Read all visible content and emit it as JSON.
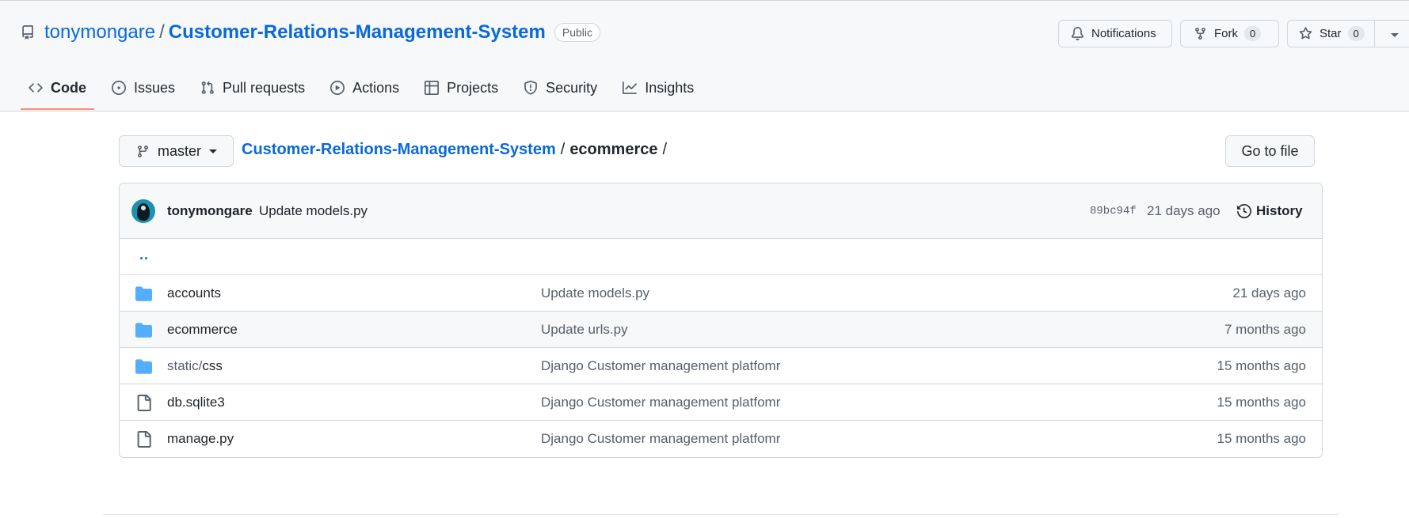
{
  "repo": {
    "owner": "tonymongare",
    "name": "Customer-Relations-Management-System",
    "visibility": "Public"
  },
  "header_actions": {
    "notifications_label": "Notifications",
    "fork_label": "Fork",
    "fork_count": "0",
    "star_label": "Star",
    "star_count": "0"
  },
  "tabs": [
    {
      "label": "Code",
      "icon": "code-icon",
      "active": true
    },
    {
      "label": "Issues",
      "icon": "issue-icon"
    },
    {
      "label": "Pull requests",
      "icon": "pull-request-icon"
    },
    {
      "label": "Actions",
      "icon": "play-icon"
    },
    {
      "label": "Projects",
      "icon": "table-icon"
    },
    {
      "label": "Security",
      "icon": "shield-icon"
    },
    {
      "label": "Insights",
      "icon": "graph-icon"
    }
  ],
  "path_bar": {
    "branch": "master",
    "breadcrumb_repo": "Customer-Relations-Management-System",
    "separator": "/",
    "current_dir": "ecommerce",
    "goto_label": "Go to file"
  },
  "latest_commit": {
    "author": "tonymongare",
    "message": "Update models.py",
    "sha": "89bc94f",
    "time": "21 days ago",
    "history_label": "History"
  },
  "parent_dir_label": "..",
  "files": [
    {
      "type": "folder",
      "name_prefix": "",
      "name": "accounts",
      "message": "Update models.py",
      "time": "21 days ago"
    },
    {
      "type": "folder",
      "name_prefix": "",
      "name": "ecommerce",
      "message": "Update urls.py",
      "time": "7 months ago"
    },
    {
      "type": "folder",
      "name_prefix": "static/",
      "name": "css",
      "message": "Django Customer management platfomr",
      "time": "15 months ago"
    },
    {
      "type": "file",
      "name_prefix": "",
      "name": "db.sqlite3",
      "message": "Django Customer management platfomr",
      "time": "15 months ago"
    },
    {
      "type": "file",
      "name_prefix": "",
      "name": "manage.py",
      "message": "Django Customer management platfomr",
      "time": "15 months ago"
    }
  ],
  "colors": {
    "link": "#0969da",
    "folder": "#54aeff",
    "active_tab_underline": "#fd8c73"
  }
}
